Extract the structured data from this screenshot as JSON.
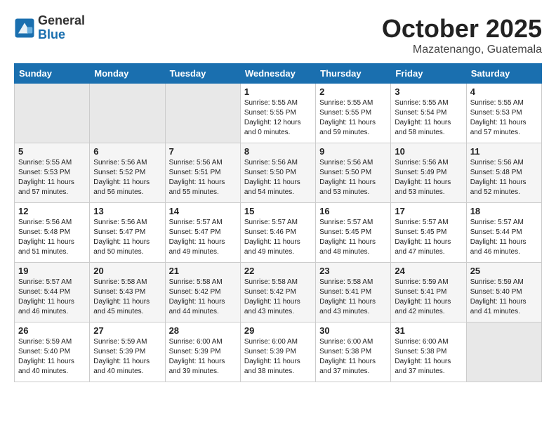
{
  "header": {
    "logo_general": "General",
    "logo_blue": "Blue",
    "month": "October 2025",
    "location": "Mazatenango, Guatemala"
  },
  "weekdays": [
    "Sunday",
    "Monday",
    "Tuesday",
    "Wednesday",
    "Thursday",
    "Friday",
    "Saturday"
  ],
  "weeks": [
    [
      {
        "day": "",
        "info": ""
      },
      {
        "day": "",
        "info": ""
      },
      {
        "day": "",
        "info": ""
      },
      {
        "day": "1",
        "info": "Sunrise: 5:55 AM\nSunset: 5:55 PM\nDaylight: 12 hours\nand 0 minutes."
      },
      {
        "day": "2",
        "info": "Sunrise: 5:55 AM\nSunset: 5:55 PM\nDaylight: 11 hours\nand 59 minutes."
      },
      {
        "day": "3",
        "info": "Sunrise: 5:55 AM\nSunset: 5:54 PM\nDaylight: 11 hours\nand 58 minutes."
      },
      {
        "day": "4",
        "info": "Sunrise: 5:55 AM\nSunset: 5:53 PM\nDaylight: 11 hours\nand 57 minutes."
      }
    ],
    [
      {
        "day": "5",
        "info": "Sunrise: 5:55 AM\nSunset: 5:53 PM\nDaylight: 11 hours\nand 57 minutes."
      },
      {
        "day": "6",
        "info": "Sunrise: 5:56 AM\nSunset: 5:52 PM\nDaylight: 11 hours\nand 56 minutes."
      },
      {
        "day": "7",
        "info": "Sunrise: 5:56 AM\nSunset: 5:51 PM\nDaylight: 11 hours\nand 55 minutes."
      },
      {
        "day": "8",
        "info": "Sunrise: 5:56 AM\nSunset: 5:50 PM\nDaylight: 11 hours\nand 54 minutes."
      },
      {
        "day": "9",
        "info": "Sunrise: 5:56 AM\nSunset: 5:50 PM\nDaylight: 11 hours\nand 53 minutes."
      },
      {
        "day": "10",
        "info": "Sunrise: 5:56 AM\nSunset: 5:49 PM\nDaylight: 11 hours\nand 53 minutes."
      },
      {
        "day": "11",
        "info": "Sunrise: 5:56 AM\nSunset: 5:48 PM\nDaylight: 11 hours\nand 52 minutes."
      }
    ],
    [
      {
        "day": "12",
        "info": "Sunrise: 5:56 AM\nSunset: 5:48 PM\nDaylight: 11 hours\nand 51 minutes."
      },
      {
        "day": "13",
        "info": "Sunrise: 5:56 AM\nSunset: 5:47 PM\nDaylight: 11 hours\nand 50 minutes."
      },
      {
        "day": "14",
        "info": "Sunrise: 5:57 AM\nSunset: 5:47 PM\nDaylight: 11 hours\nand 49 minutes."
      },
      {
        "day": "15",
        "info": "Sunrise: 5:57 AM\nSunset: 5:46 PM\nDaylight: 11 hours\nand 49 minutes."
      },
      {
        "day": "16",
        "info": "Sunrise: 5:57 AM\nSunset: 5:45 PM\nDaylight: 11 hours\nand 48 minutes."
      },
      {
        "day": "17",
        "info": "Sunrise: 5:57 AM\nSunset: 5:45 PM\nDaylight: 11 hours\nand 47 minutes."
      },
      {
        "day": "18",
        "info": "Sunrise: 5:57 AM\nSunset: 5:44 PM\nDaylight: 11 hours\nand 46 minutes."
      }
    ],
    [
      {
        "day": "19",
        "info": "Sunrise: 5:57 AM\nSunset: 5:44 PM\nDaylight: 11 hours\nand 46 minutes."
      },
      {
        "day": "20",
        "info": "Sunrise: 5:58 AM\nSunset: 5:43 PM\nDaylight: 11 hours\nand 45 minutes."
      },
      {
        "day": "21",
        "info": "Sunrise: 5:58 AM\nSunset: 5:42 PM\nDaylight: 11 hours\nand 44 minutes."
      },
      {
        "day": "22",
        "info": "Sunrise: 5:58 AM\nSunset: 5:42 PM\nDaylight: 11 hours\nand 43 minutes."
      },
      {
        "day": "23",
        "info": "Sunrise: 5:58 AM\nSunset: 5:41 PM\nDaylight: 11 hours\nand 43 minutes."
      },
      {
        "day": "24",
        "info": "Sunrise: 5:59 AM\nSunset: 5:41 PM\nDaylight: 11 hours\nand 42 minutes."
      },
      {
        "day": "25",
        "info": "Sunrise: 5:59 AM\nSunset: 5:40 PM\nDaylight: 11 hours\nand 41 minutes."
      }
    ],
    [
      {
        "day": "26",
        "info": "Sunrise: 5:59 AM\nSunset: 5:40 PM\nDaylight: 11 hours\nand 40 minutes."
      },
      {
        "day": "27",
        "info": "Sunrise: 5:59 AM\nSunset: 5:39 PM\nDaylight: 11 hours\nand 40 minutes."
      },
      {
        "day": "28",
        "info": "Sunrise: 6:00 AM\nSunset: 5:39 PM\nDaylight: 11 hours\nand 39 minutes."
      },
      {
        "day": "29",
        "info": "Sunrise: 6:00 AM\nSunset: 5:39 PM\nDaylight: 11 hours\nand 38 minutes."
      },
      {
        "day": "30",
        "info": "Sunrise: 6:00 AM\nSunset: 5:38 PM\nDaylight: 11 hours\nand 37 minutes."
      },
      {
        "day": "31",
        "info": "Sunrise: 6:00 AM\nSunset: 5:38 PM\nDaylight: 11 hours\nand 37 minutes."
      },
      {
        "day": "",
        "info": ""
      }
    ]
  ]
}
